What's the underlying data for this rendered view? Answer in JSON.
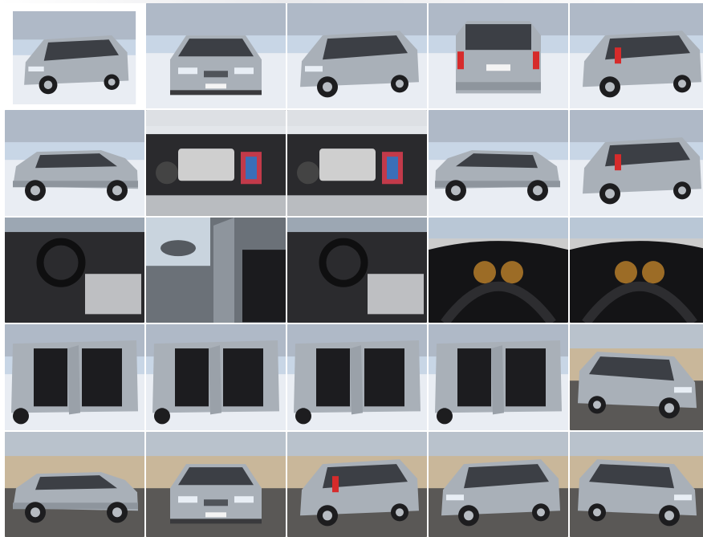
{
  "gallery": {
    "selected_index": 0,
    "colors": {
      "snow": "#e9edf3",
      "car_silver": "#a9b0b8",
      "car_dark": "#3c3f45",
      "asphalt": "#5a5856",
      "taillight": "#d62b2b",
      "interior_dark": "#1f1f22",
      "dash_amber": "#c98a2c",
      "wall_beige": "#c9b79a",
      "engine_box": "#cfcfcf",
      "sky": "#c8d6e6"
    },
    "photos": [
      {
        "scene": "snow",
        "view": "front-three-quarter-left"
      },
      {
        "scene": "snow",
        "view": "front"
      },
      {
        "scene": "snow",
        "view": "front-three-quarter-left"
      },
      {
        "scene": "snow",
        "view": "rear"
      },
      {
        "scene": "snow",
        "view": "rear-three-quarter-left"
      },
      {
        "scene": "snow",
        "view": "side-left"
      },
      {
        "scene": "engine",
        "view": "engine-bay"
      },
      {
        "scene": "engine",
        "view": "engine-bay"
      },
      {
        "scene": "snow",
        "view": "side-right"
      },
      {
        "scene": "snow",
        "view": "rear-three-quarter-left"
      },
      {
        "scene": "interior",
        "view": "front-seats"
      },
      {
        "scene": "interior",
        "view": "door-open"
      },
      {
        "scene": "interior",
        "view": "steering-wheel"
      },
      {
        "scene": "interior",
        "view": "dashboard"
      },
      {
        "scene": "interior",
        "view": "instrument-cluster"
      },
      {
        "scene": "snow",
        "view": "doors-open-left"
      },
      {
        "scene": "snow",
        "view": "doors-open-side"
      },
      {
        "scene": "snow",
        "view": "doors-open-rear"
      },
      {
        "scene": "snow",
        "view": "doors-open-side"
      },
      {
        "scene": "yard",
        "view": "front-three-quarter-right"
      },
      {
        "scene": "yard",
        "view": "side-left"
      },
      {
        "scene": "yard",
        "view": "front"
      },
      {
        "scene": "yard",
        "view": "rear-three-quarter-left"
      },
      {
        "scene": "yard",
        "view": "front-three-quarter-left"
      },
      {
        "scene": "yard",
        "view": "front-three-quarter-right"
      }
    ]
  }
}
